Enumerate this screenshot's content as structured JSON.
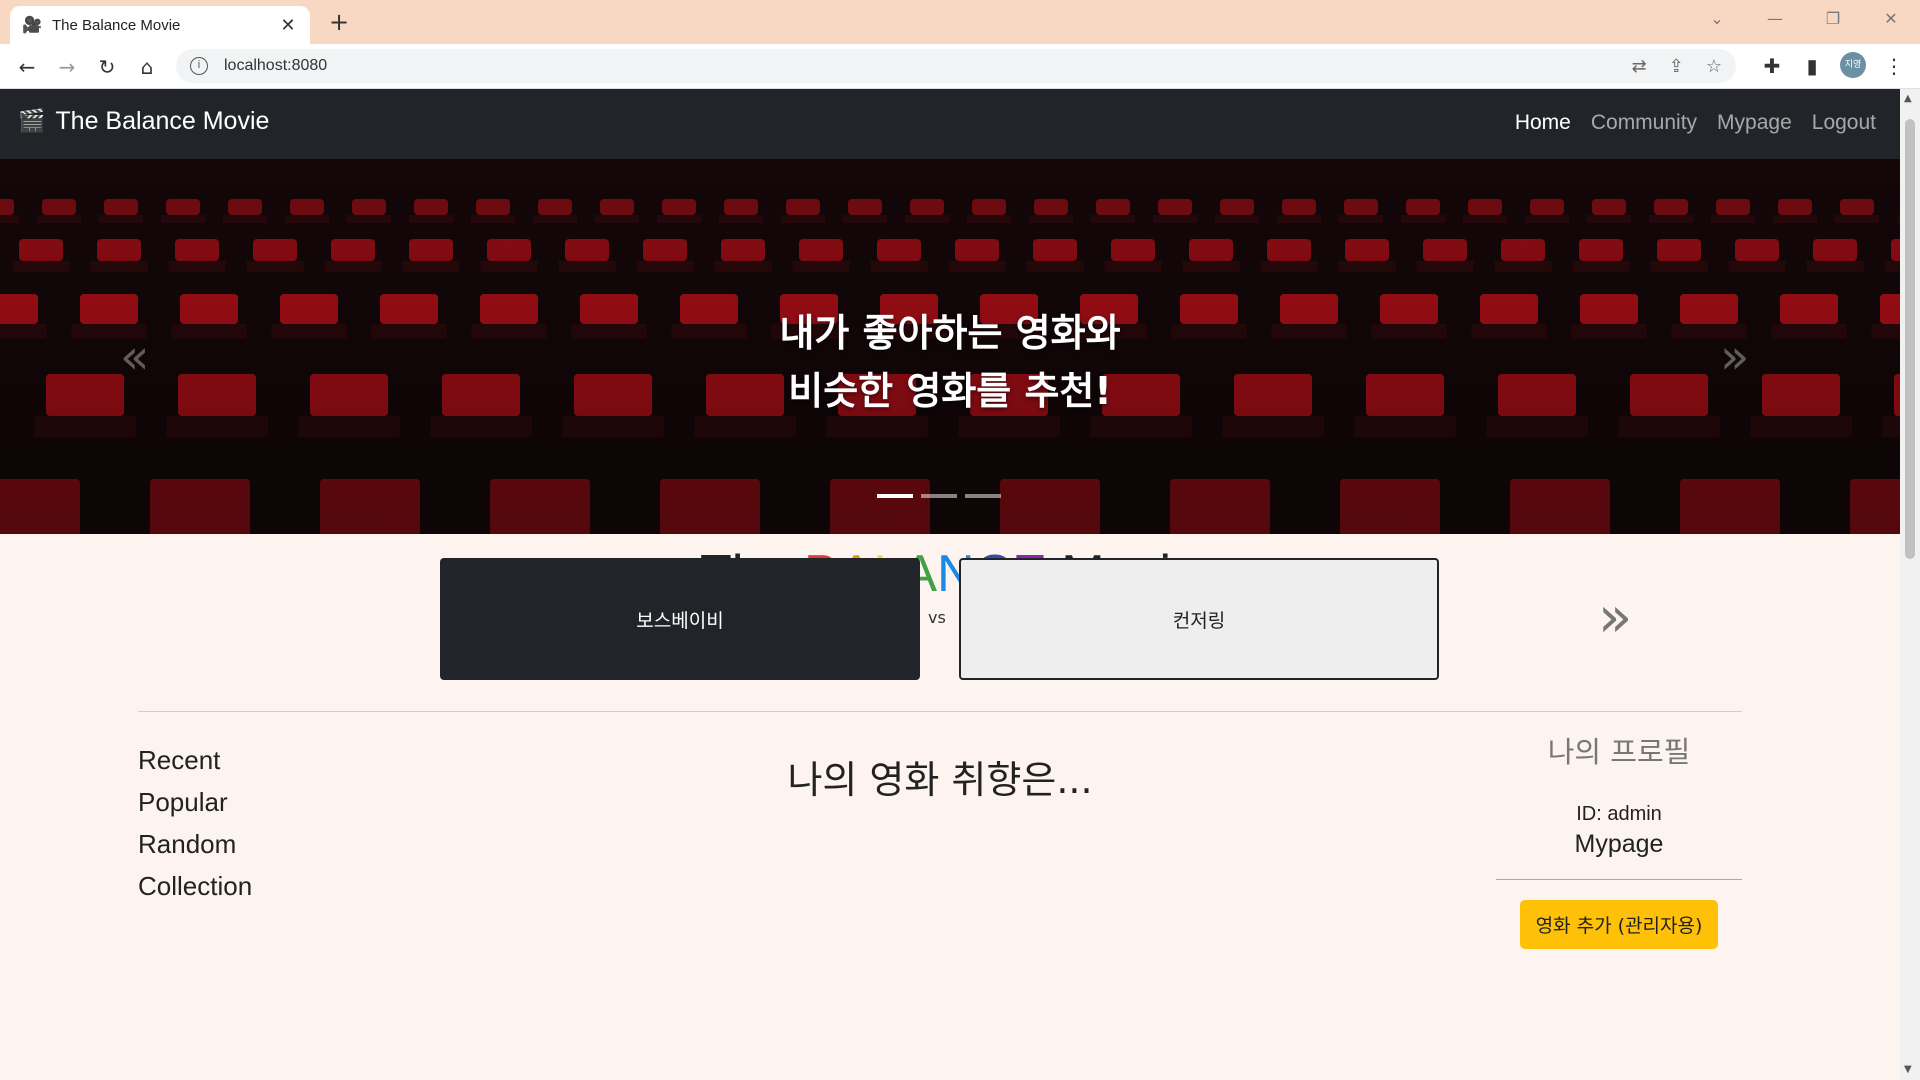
{
  "browser": {
    "tab_title": "The Balance Movie",
    "url": "localhost:8080",
    "profile_initials": "지영"
  },
  "navbar": {
    "brand": "The Balance Movie",
    "links": [
      "Home",
      "Community",
      "Mypage",
      "Logout"
    ],
    "active_link": "Home"
  },
  "hero": {
    "line1": "내가 좋아하는 영화와",
    "line2": "비슷한 영화를 추천!",
    "prev_glyph": "«",
    "next_glyph": "»",
    "slide_count": 3,
    "active_slide": 1
  },
  "title": {
    "prefix": "The ",
    "balance_letters": [
      "B",
      "A",
      "L",
      "A",
      "N",
      "C",
      "E"
    ],
    "balance_colors": [
      "#e53935",
      "#fb8c00",
      "#fdd835",
      "#43a047",
      "#1e88e5",
      "#3949ab",
      "#8e24aa"
    ],
    "suffix": " Movie"
  },
  "balance": {
    "left_movie": "보스베이비",
    "vs": "vs",
    "right_movie": "컨저링",
    "next_glyph": "»"
  },
  "side_menu": [
    "Recent",
    "Popular",
    "Random",
    "Collection"
  ],
  "taste_heading": "나의 영화 취향은...",
  "profile": {
    "title": "나의 프로필",
    "id_text": "ID: admin",
    "mypage": "Mypage",
    "admin_button": "영화 추가 (관리자용)"
  },
  "colors": {
    "navbar_bg": "#212529",
    "page_bg": "#fdf4ef",
    "admin_button": "#ffc107",
    "seat_red": "#c8101a"
  }
}
